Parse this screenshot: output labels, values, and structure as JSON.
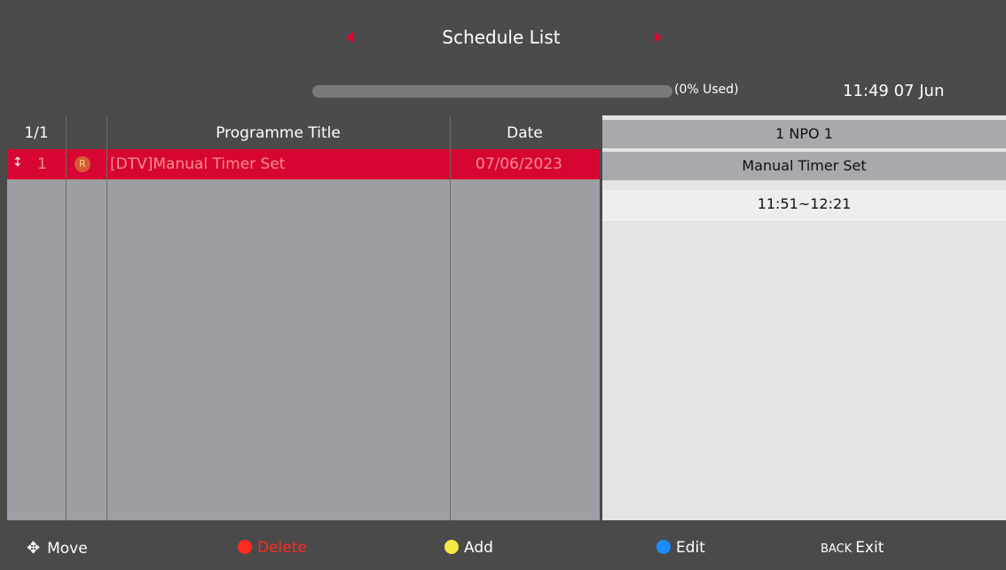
{
  "header": {
    "title": "Schedule List",
    "storage_used": 0,
    "storage_text": "(0% Used)",
    "clock": "11:49 07 Jun"
  },
  "table": {
    "page": "1/1",
    "columns": [
      "Programme Title",
      "Date"
    ],
    "rows": [
      {
        "index": "1",
        "badge": "R",
        "title": "[DTV]Manual Timer Set",
        "date": "07/06/2023"
      }
    ]
  },
  "detail": {
    "channel": "1 NPO 1",
    "event": "Manual Timer Set",
    "time": "11:51~12:21"
  },
  "footer": {
    "move": "Move",
    "delete": "Delete",
    "add": "Add",
    "edit": "Edit",
    "back_key": "BACK",
    "exit": "Exit"
  },
  "colors": {
    "selection": "#d70531",
    "red_key": "#ff2b1e",
    "yellow_key": "#f4ea42",
    "blue_key": "#1b8cff"
  }
}
